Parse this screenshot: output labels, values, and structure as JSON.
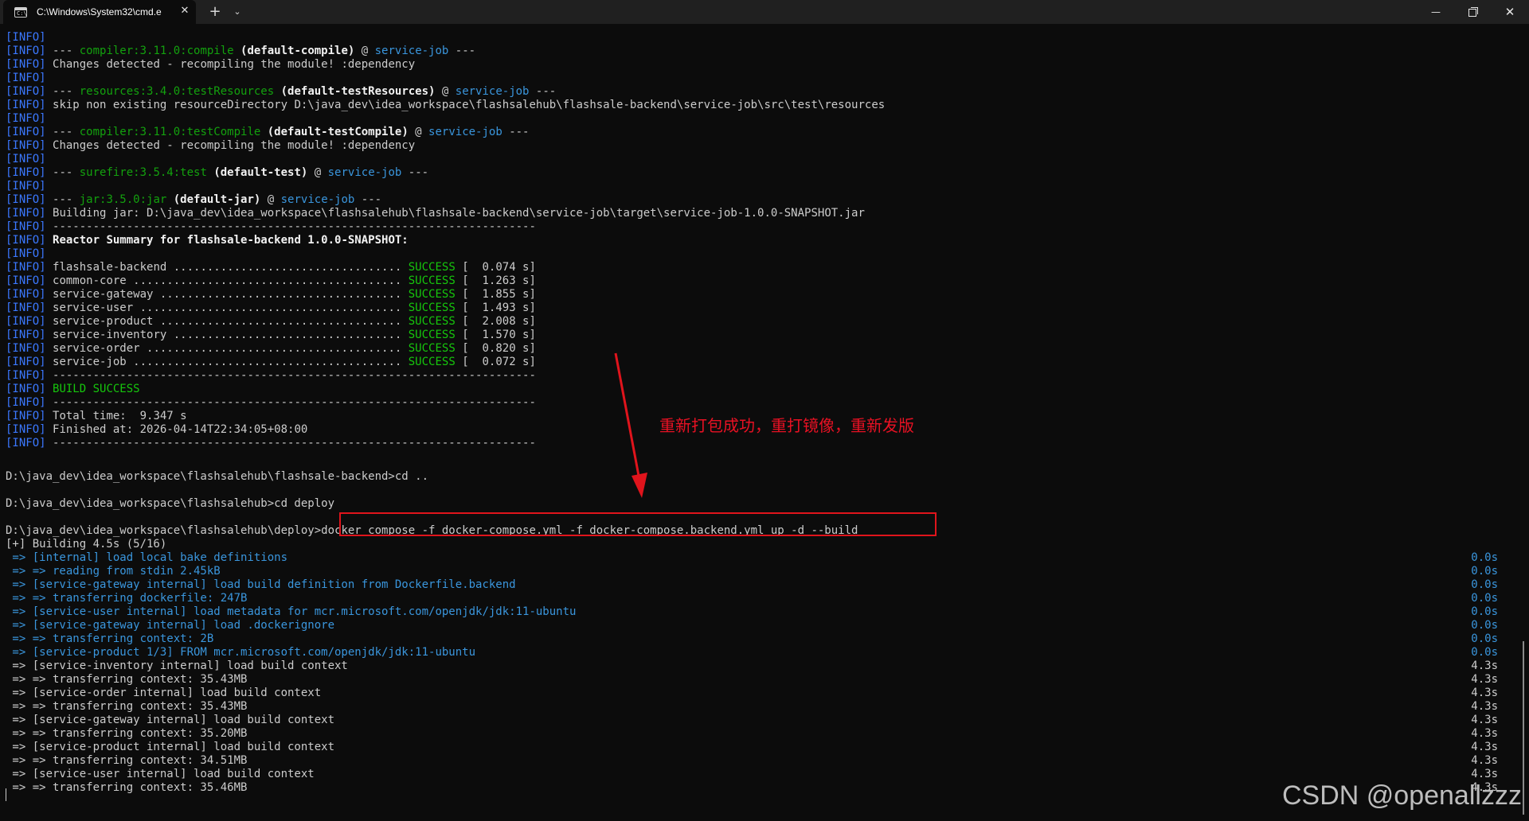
{
  "window": {
    "tab_icon_text": "C:\\",
    "tab_title": "C:\\Windows\\System32\\cmd.e",
    "tab_close": "✕",
    "new_tab": "+",
    "tab_dropdown": "⌄",
    "minimize": "—",
    "close": "✕"
  },
  "terminal": {
    "info_tag": "[INFO]",
    "info_lines": [
      [
        [
          "w",
          ""
        ]
      ],
      [
        [
          "w",
          "--- "
        ],
        [
          "g",
          "compiler:3.11.0:compile"
        ],
        [
          "b",
          " (default-compile)"
        ],
        [
          "w",
          " @ "
        ],
        [
          "c",
          "service-job"
        ],
        [
          "w",
          " ---"
        ]
      ],
      [
        [
          "w",
          "Changes detected - recompiling the module! :dependency"
        ]
      ],
      [
        [
          "w",
          ""
        ]
      ],
      [
        [
          "w",
          "--- "
        ],
        [
          "g",
          "resources:3.4.0:testResources"
        ],
        [
          "b",
          " (default-testResources)"
        ],
        [
          "w",
          " @ "
        ],
        [
          "c",
          "service-job"
        ],
        [
          "w",
          " ---"
        ]
      ],
      [
        [
          "w",
          "skip non existing resourceDirectory D:\\java_dev\\idea_workspace\\flashsalehub\\flashsale-backend\\service-job\\src\\test\\resources"
        ]
      ],
      [
        [
          "w",
          ""
        ]
      ],
      [
        [
          "w",
          "--- "
        ],
        [
          "g",
          "compiler:3.11.0:testCompile"
        ],
        [
          "b",
          " (default-testCompile)"
        ],
        [
          "w",
          " @ "
        ],
        [
          "c",
          "service-job"
        ],
        [
          "w",
          " ---"
        ]
      ],
      [
        [
          "w",
          "Changes detected - recompiling the module! :dependency"
        ]
      ],
      [
        [
          "w",
          ""
        ]
      ],
      [
        [
          "w",
          "--- "
        ],
        [
          "g",
          "surefire:3.5.4:test"
        ],
        [
          "b",
          " (default-test)"
        ],
        [
          "w",
          " @ "
        ],
        [
          "c",
          "service-job"
        ],
        [
          "w",
          " ---"
        ]
      ],
      [
        [
          "w",
          ""
        ]
      ],
      [
        [
          "w",
          "--- "
        ],
        [
          "g",
          "jar:3.5.0:jar"
        ],
        [
          "b",
          " (default-jar)"
        ],
        [
          "w",
          " @ "
        ],
        [
          "c",
          "service-job"
        ],
        [
          "w",
          " ---"
        ]
      ],
      [
        [
          "w",
          "Building jar: D:\\java_dev\\idea_workspace\\flashsalehub\\flashsale-backend\\service-job\\target\\service-job-1.0.0-SNAPSHOT.jar"
        ]
      ],
      [
        [
          "w",
          "------------------------------------------------------------------------"
        ]
      ],
      [
        [
          "b",
          "Reactor Summary for flashsale-backend 1.0.0-SNAPSHOT:"
        ]
      ],
      [
        [
          "w",
          ""
        ]
      ],
      [
        [
          "w",
          "flashsale-backend .................................. "
        ],
        [
          "s",
          "SUCCESS"
        ],
        [
          "w",
          " [  0.074 s]"
        ]
      ],
      [
        [
          "w",
          "common-core ........................................ "
        ],
        [
          "s",
          "SUCCESS"
        ],
        [
          "w",
          " [  1.263 s]"
        ]
      ],
      [
        [
          "w",
          "service-gateway .................................... "
        ],
        [
          "s",
          "SUCCESS"
        ],
        [
          "w",
          " [  1.855 s]"
        ]
      ],
      [
        [
          "w",
          "service-user ....................................... "
        ],
        [
          "s",
          "SUCCESS"
        ],
        [
          "w",
          " [  1.493 s]"
        ]
      ],
      [
        [
          "w",
          "service-product .................................... "
        ],
        [
          "s",
          "SUCCESS"
        ],
        [
          "w",
          " [  2.008 s]"
        ]
      ],
      [
        [
          "w",
          "service-inventory .................................. "
        ],
        [
          "s",
          "SUCCESS"
        ],
        [
          "w",
          " [  1.570 s]"
        ]
      ],
      [
        [
          "w",
          "service-order ...................................... "
        ],
        [
          "s",
          "SUCCESS"
        ],
        [
          "w",
          " [  0.820 s]"
        ]
      ],
      [
        [
          "w",
          "service-job ........................................ "
        ],
        [
          "s",
          "SUCCESS"
        ],
        [
          "w",
          " [  0.072 s]"
        ]
      ],
      [
        [
          "w",
          "------------------------------------------------------------------------"
        ]
      ],
      [
        [
          "s",
          "BUILD SUCCESS"
        ]
      ],
      [
        [
          "w",
          "------------------------------------------------------------------------"
        ]
      ],
      [
        [
          "w",
          "Total time:  9.347 s"
        ]
      ],
      [
        [
          "w",
          "Finished at: 2026-04-14T22:34:05+08:00"
        ]
      ],
      [
        [
          "w",
          "------------------------------------------------------------------------"
        ]
      ]
    ],
    "prompt_cd_up": "D:\\java_dev\\idea_workspace\\flashsalehub\\flashsale-backend>cd ..",
    "prompt_cd_deploy": "D:\\java_dev\\idea_workspace\\flashsalehub>cd deploy",
    "prompt_deploy": "D:\\java_dev\\idea_workspace\\flashsalehub\\deploy>",
    "command": "docker compose -f docker-compose.yml -f docker-compose.backend.yml up -d --build",
    "building_status": "[+] Building 4.5s (5/16)",
    "build_steps": [
      {
        "text": " => [internal] load local bake definitions",
        "time": "0.0s",
        "done": true
      },
      {
        "text": " => => reading from stdin 2.45kB",
        "time": "0.0s",
        "done": true
      },
      {
        "text": " => [service-gateway internal] load build definition from Dockerfile.backend",
        "time": "0.0s",
        "done": true
      },
      {
        "text": " => => transferring dockerfile: 247B",
        "time": "0.0s",
        "done": true
      },
      {
        "text": " => [service-user internal] load metadata for mcr.microsoft.com/openjdk/jdk:11-ubuntu",
        "time": "0.0s",
        "done": true
      },
      {
        "text": " => [service-gateway internal] load .dockerignore",
        "time": "0.0s",
        "done": true
      },
      {
        "text": " => => transferring context: 2B",
        "time": "0.0s",
        "done": true
      },
      {
        "text": " => [service-product 1/3] FROM mcr.microsoft.com/openjdk/jdk:11-ubuntu",
        "time": "0.0s",
        "done": true
      },
      {
        "text": " => [service-inventory internal] load build context",
        "time": "4.3s",
        "done": false
      },
      {
        "text": " => => transferring context: 35.43MB",
        "time": "4.3s",
        "done": false
      },
      {
        "text": " => [service-order internal] load build context",
        "time": "4.3s",
        "done": false
      },
      {
        "text": " => => transferring context: 35.43MB",
        "time": "4.3s",
        "done": false
      },
      {
        "text": " => [service-gateway internal] load build context",
        "time": "4.3s",
        "done": false
      },
      {
        "text": " => => transferring context: 35.20MB",
        "time": "4.3s",
        "done": false
      },
      {
        "text": " => [service-product internal] load build context",
        "time": "4.3s",
        "done": false
      },
      {
        "text": " => => transferring context: 34.51MB",
        "time": "4.3s",
        "done": false
      },
      {
        "text": " => [service-user internal] load build context",
        "time": "4.3s",
        "done": false
      },
      {
        "text": " => => transferring context: 35.46MB",
        "time": "4.3s",
        "done": false
      }
    ]
  },
  "annotation": {
    "text": "重新打包成功，重打镜像，重新发版",
    "color": "#e81123"
  },
  "watermark": "CSDN @openallzzz",
  "colors": {
    "background": "#0c0c0c",
    "info": "#3b78ff",
    "plugin": "#13a10e",
    "success": "#16c60c",
    "project": "#3a96dd",
    "highlight_box": "#e0141c"
  }
}
